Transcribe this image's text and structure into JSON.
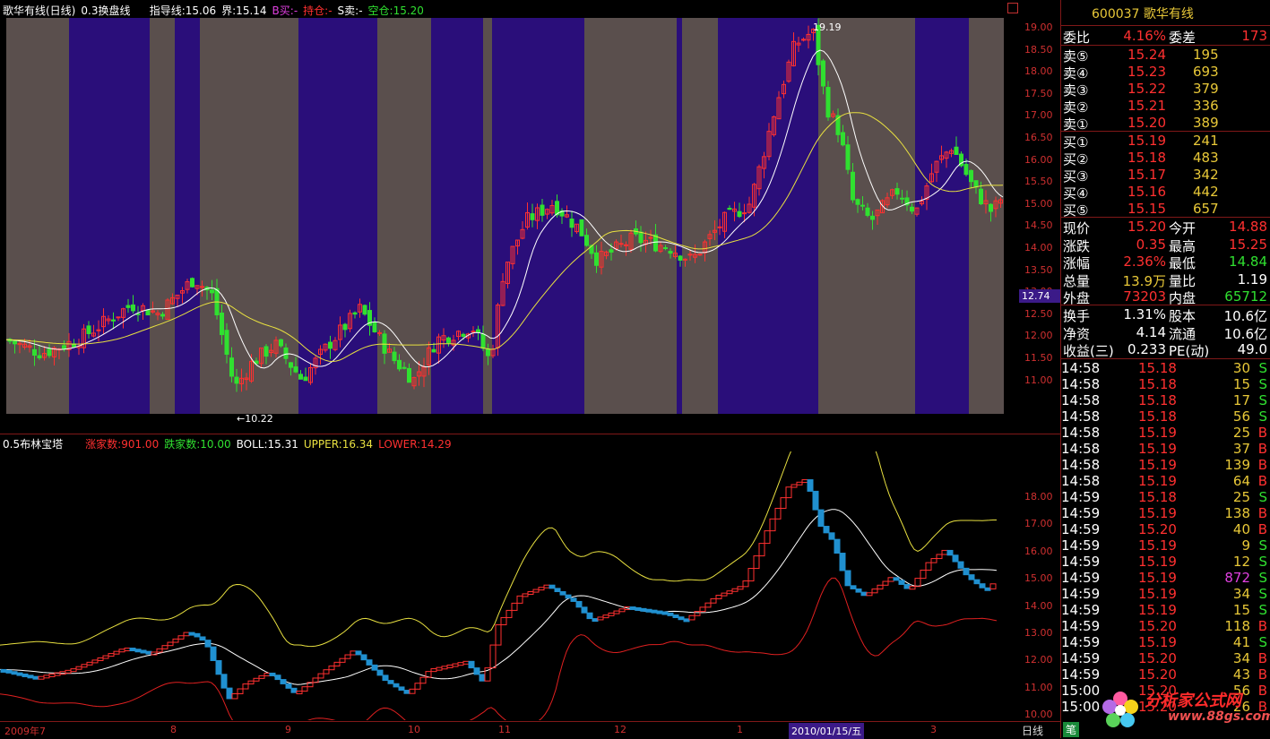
{
  "main_header": {
    "title": "歌华有线(日线)",
    "indicator": "0.3换盘线",
    "guide": "指导线:15.06",
    "boundary": "界:15.14",
    "buy": "B买:-",
    "hold": "持仓:-",
    "sell": "S卖:-",
    "empty": "空仓:15.20"
  },
  "sub_header": {
    "indicator": "0.5布林宝塔",
    "up_count": "涨家数:901.00",
    "down_count": "跌家数:10.00",
    "boll": "BOLL:15.31",
    "upper": "UPPER:16.34",
    "lower": "LOWER:14.29"
  },
  "annotations": {
    "high": "19.19",
    "low": "←10.22"
  },
  "main_axis": [
    "19.00",
    "18.50",
    "18.00",
    "17.50",
    "17.00",
    "16.50",
    "16.00",
    "15.50",
    "15.00",
    "14.50",
    "14.00",
    "13.50",
    "13.00",
    "12.50",
    "12.00",
    "11.50",
    "11.00"
  ],
  "main_axis_highlight": "12.74",
  "sub_axis": [
    "18.00",
    "17.00",
    "16.00",
    "15.00",
    "14.00",
    "13.00",
    "12.00",
    "11.00",
    "10.00"
  ],
  "dates": [
    "2009年7",
    "8",
    "9",
    "10",
    "11",
    "12",
    "1",
    "3"
  ],
  "date_highlight": "2010/01/15/五",
  "period": "日线",
  "tab_pen": "笔",
  "colors": {
    "up": "#ff3030",
    "down": "#30e030",
    "band_purple": "#2a0e7a",
    "band_gray": "#5a4f4d"
  },
  "quote": {
    "code": "600037",
    "name": "歌华有线",
    "weibi_label": "委比",
    "weibi": "4.16%",
    "weicha_label": "委差",
    "weicha": "173",
    "asks": [
      {
        "label": "卖⑤",
        "price": "15.24",
        "vol": "195"
      },
      {
        "label": "卖④",
        "price": "15.23",
        "vol": "693"
      },
      {
        "label": "卖③",
        "price": "15.22",
        "vol": "379"
      },
      {
        "label": "卖②",
        "price": "15.21",
        "vol": "336"
      },
      {
        "label": "卖①",
        "price": "15.20",
        "vol": "389"
      }
    ],
    "bids": [
      {
        "label": "买①",
        "price": "15.19",
        "vol": "241"
      },
      {
        "label": "买②",
        "price": "15.18",
        "vol": "483"
      },
      {
        "label": "买③",
        "price": "15.17",
        "vol": "342"
      },
      {
        "label": "买④",
        "price": "15.16",
        "vol": "442"
      },
      {
        "label": "买⑤",
        "price": "15.15",
        "vol": "657"
      }
    ],
    "stats": [
      {
        "l1": "现价",
        "v1": "15.20",
        "c1": "red",
        "l2": "今开",
        "v2": "14.88",
        "c2": "red"
      },
      {
        "l1": "涨跌",
        "v1": "0.35",
        "c1": "red",
        "l2": "最高",
        "v2": "15.25",
        "c2": "red"
      },
      {
        "l1": "涨幅",
        "v1": "2.36%",
        "c1": "red",
        "l2": "最低",
        "v2": "14.84",
        "c2": "grn"
      },
      {
        "l1": "总量",
        "v1": "13.9万",
        "c1": "yel",
        "l2": "量比",
        "v2": "1.19",
        "c2": "wht"
      },
      {
        "l1": "外盘",
        "v1": "73203",
        "c1": "red",
        "l2": "内盘",
        "v2": "65712",
        "c2": "grn"
      }
    ],
    "stats2": [
      {
        "l1": "换手",
        "v1": "1.31%",
        "l2": "股本",
        "v2": "10.6亿"
      },
      {
        "l1": "净资",
        "v1": "4.14",
        "l2": "流通",
        "v2": "10.6亿"
      },
      {
        "l1": "收益(三)",
        "v1": "0.233",
        "l2": "PE(动)",
        "v2": "49.0"
      }
    ]
  },
  "ticks": [
    {
      "t": "14:58",
      "p": "15.18",
      "q": "30",
      "s": "S"
    },
    {
      "t": "14:58",
      "p": "15.18",
      "q": "15",
      "s": "S"
    },
    {
      "t": "14:58",
      "p": "15.18",
      "q": "17",
      "s": "S"
    },
    {
      "t": "14:58",
      "p": "15.18",
      "q": "56",
      "s": "S"
    },
    {
      "t": "14:58",
      "p": "15.19",
      "q": "25",
      "s": "B"
    },
    {
      "t": "14:58",
      "p": "15.19",
      "q": "37",
      "s": "B"
    },
    {
      "t": "14:58",
      "p": "15.19",
      "q": "139",
      "s": "B"
    },
    {
      "t": "14:58",
      "p": "15.19",
      "q": "64",
      "s": "B"
    },
    {
      "t": "14:59",
      "p": "15.18",
      "q": "25",
      "s": "S"
    },
    {
      "t": "14:59",
      "p": "15.19",
      "q": "138",
      "s": "B"
    },
    {
      "t": "14:59",
      "p": "15.20",
      "q": "40",
      "s": "B"
    },
    {
      "t": "14:59",
      "p": "15.19",
      "q": "9",
      "s": "S"
    },
    {
      "t": "14:59",
      "p": "15.19",
      "q": "12",
      "s": "S"
    },
    {
      "t": "14:59",
      "p": "15.19",
      "q": "872",
      "s": "S"
    },
    {
      "t": "14:59",
      "p": "15.19",
      "q": "34",
      "s": "S"
    },
    {
      "t": "14:59",
      "p": "15.19",
      "q": "15",
      "s": "S"
    },
    {
      "t": "14:59",
      "p": "15.20",
      "q": "118",
      "s": "B"
    },
    {
      "t": "14:59",
      "p": "15.19",
      "q": "41",
      "s": "S"
    },
    {
      "t": "14:59",
      "p": "15.20",
      "q": "34",
      "s": "B"
    },
    {
      "t": "14:59",
      "p": "15.20",
      "q": "43",
      "s": "B"
    },
    {
      "t": "15:00",
      "p": "15.20",
      "q": "56",
      "s": "B"
    },
    {
      "t": "15:00",
      "p": "15.20",
      "q": "26",
      "s": "B"
    }
  ],
  "logo": {
    "text": "分析家公式网",
    "url": "www.88gs.com"
  }
}
